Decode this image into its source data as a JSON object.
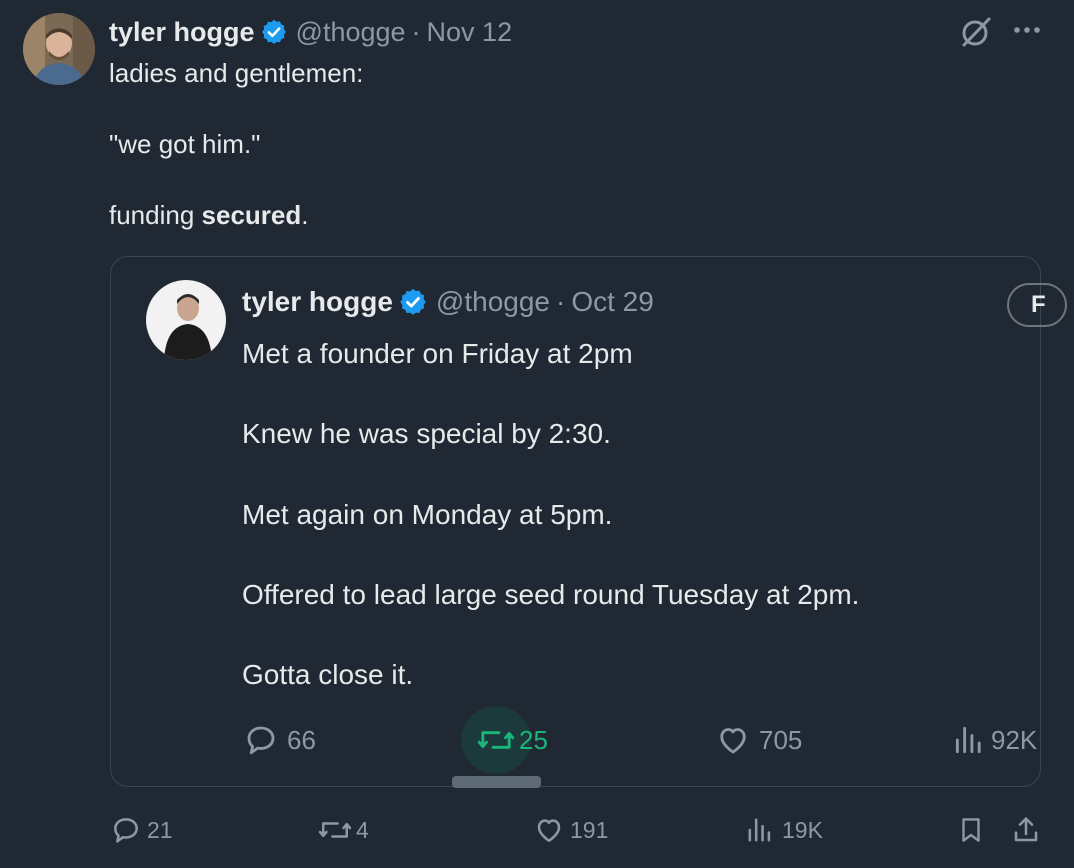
{
  "post": {
    "author_name": "tyler hogge",
    "handle": "@thogge",
    "separator": "·",
    "date": "Nov 12",
    "lines": {
      "l1": "ladies and gentlemen:",
      "l2": "\"we got him.\"",
      "l3_a": "funding ",
      "l3_b": "secured",
      "l3_c": "."
    },
    "stats": {
      "replies": "21",
      "reposts": "4",
      "likes": "191",
      "views": "19K"
    }
  },
  "quoted_post": {
    "author_name": "tyler hogge",
    "handle": "@thogge",
    "separator": "·",
    "date": "Oct 29",
    "lines": {
      "l1": "Met a founder on Friday at 2pm",
      "l2": "Knew he was special by 2:30.",
      "l3": "Met again on Monday at 5pm.",
      "l4": "Offered to lead large seed round Tuesday at 2pm.",
      "l5": "Gotta close it."
    },
    "follow_label": "F",
    "stats": {
      "replies": "66",
      "reposts": "25",
      "likes": "705",
      "views": "92K"
    }
  },
  "icons": {
    "verified": "verified-badge-icon",
    "grok": "grok-icon",
    "more": "more-icon",
    "reply": "reply-icon",
    "repost": "repost-icon",
    "like": "like-icon",
    "views": "views-icon",
    "bookmark": "bookmark-icon",
    "share": "share-icon"
  },
  "colors": {
    "background": "#202833",
    "text": "#e7e9ea",
    "secondary": "#8b98a5",
    "verified": "#1d9bf0",
    "repost_active": "#19b87a",
    "border": "#3b4651"
  }
}
